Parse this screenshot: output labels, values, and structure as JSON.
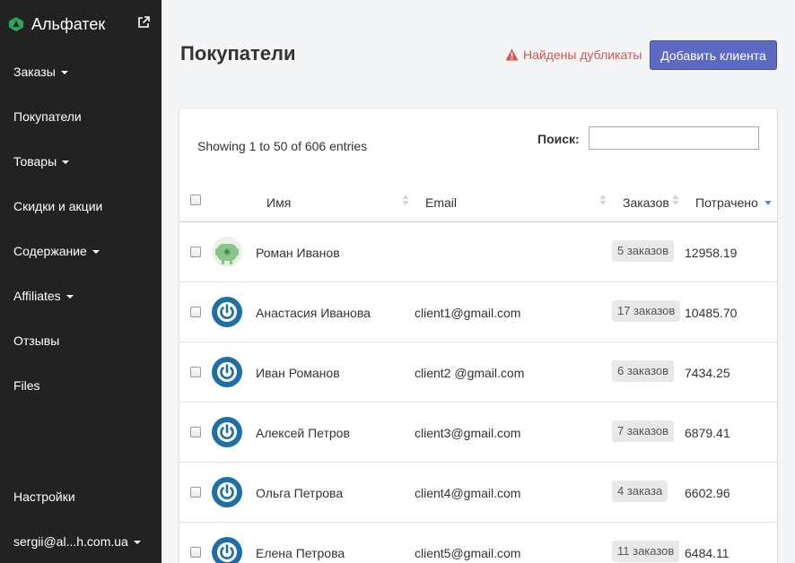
{
  "sidebar": {
    "brand": "Альфатек",
    "items": [
      {
        "label": "Заказы",
        "caret": true
      },
      {
        "label": "Покупатели",
        "caret": false
      },
      {
        "label": "Товары",
        "caret": true
      },
      {
        "label": "Скидки и акции",
        "caret": false
      },
      {
        "label": "Содержание",
        "caret": true
      },
      {
        "label": "Affiliates",
        "caret": true
      },
      {
        "label": "Отзывы",
        "caret": false
      },
      {
        "label": "Files",
        "caret": false
      }
    ],
    "settings": "Настройки",
    "user": "sergii@al...h.com.ua"
  },
  "header": {
    "title": "Покупатели",
    "warning": "Найдены дубликаты",
    "add_button": "Добавить клиента"
  },
  "table": {
    "info": "Showing 1 to 50 of 606 entries",
    "search_label": "Поиск:",
    "search_value": "",
    "columns": {
      "name": "Имя",
      "email": "Email",
      "orders": "Заказов",
      "spent": "Потрачено"
    },
    "rows": [
      {
        "name": "Роман Иванов",
        "email": "",
        "orders": "5 заказов",
        "spent": "12958.19",
        "avatar": "robot"
      },
      {
        "name": "Анастасия Иванова",
        "email": "client1@gmail.com",
        "orders": "17 заказов",
        "spent": "10485.70",
        "avatar": "power"
      },
      {
        "name": "Иван Романов",
        "email": "client2 @gmail.com",
        "orders": "6 заказов",
        "spent": "7434.25",
        "avatar": "power"
      },
      {
        "name": "Алексей Петров",
        "email": "client3@gmail.com",
        "orders": "7 заказов",
        "spent": "6879.41",
        "avatar": "power"
      },
      {
        "name": "Ольга Петрова",
        "email": "client4@gmail.com",
        "orders": "4 заказа",
        "spent": "6602.96",
        "avatar": "power"
      },
      {
        "name": "Елена Петрова",
        "email": "client5@gmail.com",
        "orders": "11 заказов",
        "spent": "6484.11",
        "avatar": "power"
      }
    ]
  },
  "colors": {
    "sidebar_bg": "#222222",
    "accent": "#5c6ac4",
    "warning": "#d9534f",
    "brand_logo": "#2ea55a",
    "avatar_power": "#1d6fa5",
    "avatar_robot": "#8bc58b"
  }
}
